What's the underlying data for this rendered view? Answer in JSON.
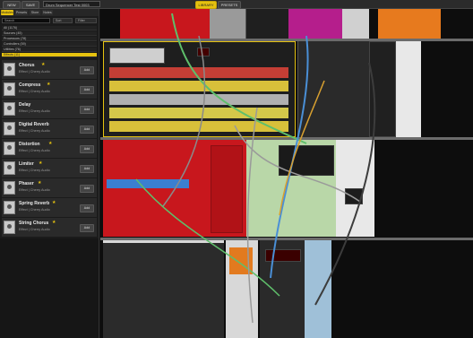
{
  "topbar": {
    "btn_new": "NEW",
    "btn_save": "SAVE",
    "preset_name": "Drum Sequencer Test 0003",
    "btn_library": "LIBRARY",
    "btn_presets": "PRESETS"
  },
  "sidebar": {
    "tabs": [
      "Modules",
      "Presets",
      "Store",
      "Notes"
    ],
    "search_placeholder": "Search",
    "sort_label": "Sort",
    "filter_label": "Filter",
    "categories": [
      "All (1176)",
      "Sources (45)",
      "Processors (78)",
      "Controllers (59)",
      "Utilities (76)",
      "Effects (11)"
    ],
    "selected_category_index": 5,
    "items": [
      {
        "name": "Chorus",
        "starred": true,
        "desc": "Effect  |  Cherry Audio",
        "add": "Add"
      },
      {
        "name": "Compress",
        "starred": true,
        "desc": "Effect  |  Cherry Audio",
        "add": "Add"
      },
      {
        "name": "Delay",
        "starred": false,
        "desc": "Effect  |  Cherry Audio",
        "add": "Add"
      },
      {
        "name": "Digital Reverb",
        "starred": false,
        "desc": "Effect  |  Cherry Audio",
        "add": "Add"
      },
      {
        "name": "Distortion",
        "starred": true,
        "desc": "Effect  |  Cherry Audio",
        "add": "Add"
      },
      {
        "name": "Limiter",
        "starred": true,
        "desc": "Effect  |  Cherry Audio",
        "add": "Add"
      },
      {
        "name": "Phaser",
        "starred": true,
        "desc": "Effect  |  Cherry Audio",
        "add": "Add"
      },
      {
        "name": "Spring Reverb",
        "starred": true,
        "desc": "Effect  |  Cherry Audio",
        "add": "Add"
      },
      {
        "name": "String Chorus",
        "starred": true,
        "desc": "Effect  |  Cherry Audio",
        "add": "Add"
      }
    ]
  },
  "rack": {
    "colors": {
      "accent": "#e6c20f",
      "red_module": "#c8171d",
      "green_module": "#b9d7a8",
      "blue_module": "#9fc0d8",
      "seq_yellow": "#e2d44a",
      "seq_red": "#d24a3d",
      "cable_green": "#5fbf6b",
      "cable_blue": "#4a8fd6",
      "cable_grey": "#9a9a9a"
    }
  }
}
